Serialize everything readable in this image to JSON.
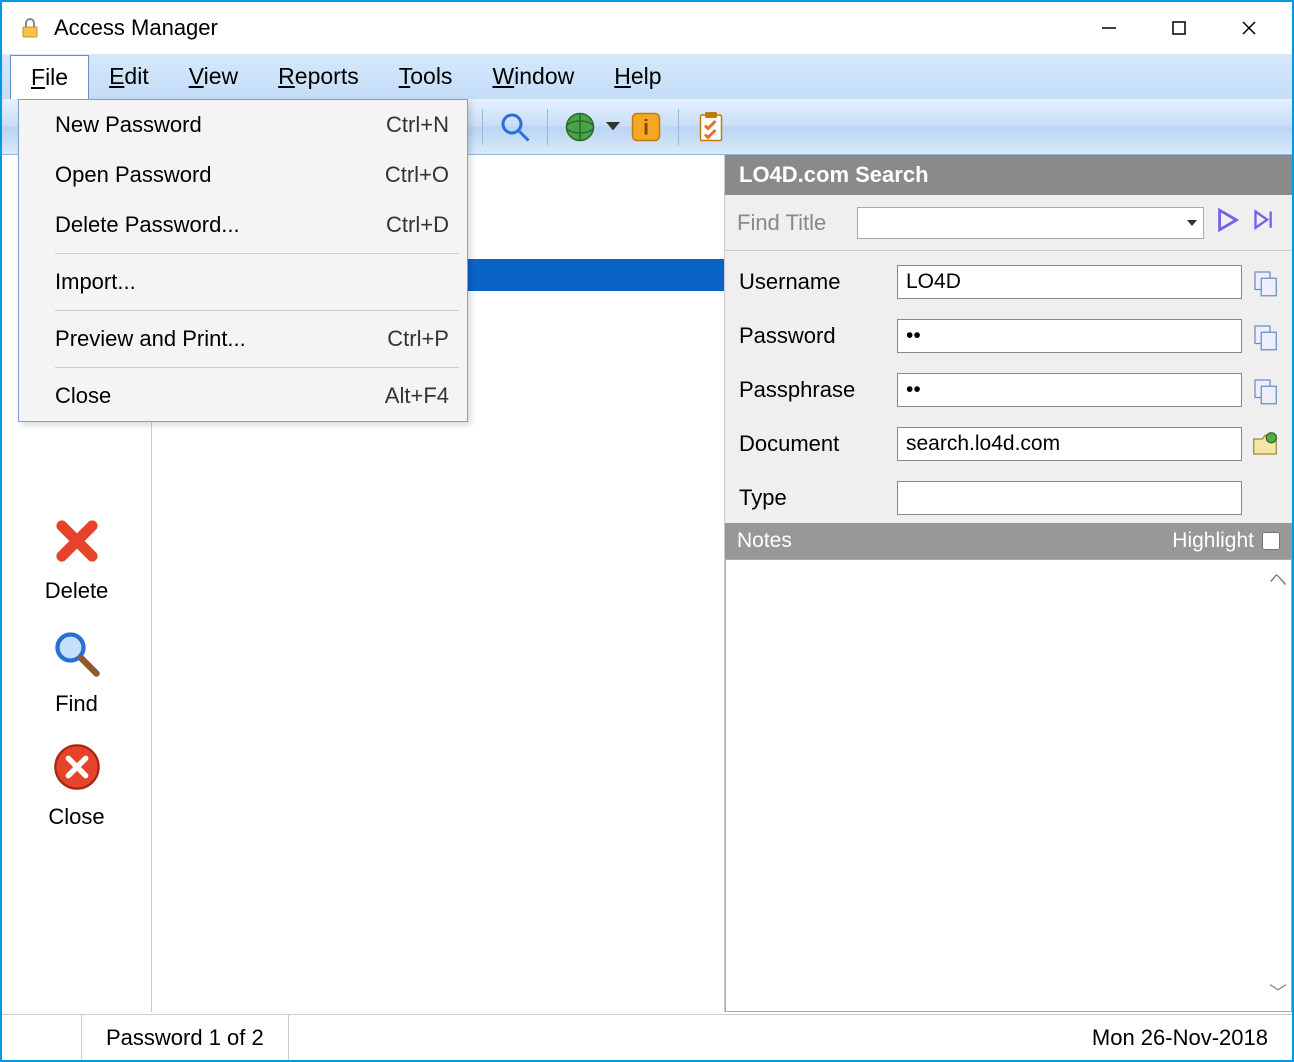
{
  "window": {
    "title": "Access Manager"
  },
  "menubar": {
    "file": "File",
    "edit": "Edit",
    "view": "View",
    "reports": "Reports",
    "tools": "Tools",
    "window": "Window",
    "help": "Help"
  },
  "file_menu": {
    "new": {
      "label": "New Password",
      "shortcut": "Ctrl+N"
    },
    "open": {
      "label": "Open Password",
      "shortcut": "Ctrl+O"
    },
    "delete": {
      "label": "Delete Password...",
      "shortcut": "Ctrl+D"
    },
    "import": {
      "label": "Import..."
    },
    "preview": {
      "label": "Preview and Print...",
      "shortcut": "Ctrl+P"
    },
    "close": {
      "label": "Close",
      "shortcut": "Alt+F4"
    }
  },
  "sidebar": {
    "delete": "Delete",
    "find": "Find",
    "close": "Close"
  },
  "detail": {
    "title": "LO4D.com Search",
    "find_label": "Find Title",
    "fields": {
      "username": {
        "label": "Username",
        "value": "LO4D"
      },
      "password": {
        "label": "Password",
        "value": "••"
      },
      "passphrase": {
        "label": "Passphrase",
        "value": "••"
      },
      "document": {
        "label": "Document",
        "value": "search.lo4d.com"
      },
      "type": {
        "label": "Type",
        "value": ""
      }
    },
    "notes": {
      "label": "Notes",
      "highlight_label": "Highlight"
    }
  },
  "status": {
    "count": "Password 1 of 2",
    "date": "Mon 26-Nov-2018"
  }
}
